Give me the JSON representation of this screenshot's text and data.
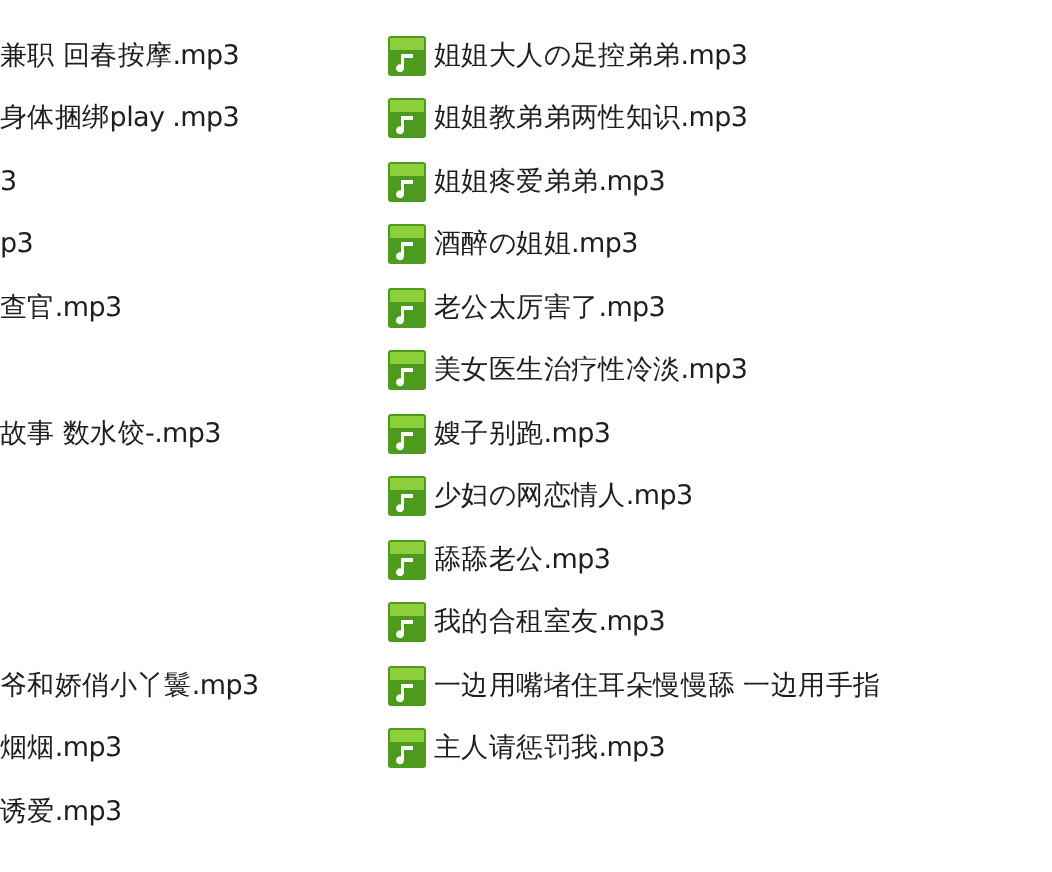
{
  "columns": [
    {
      "groups": [
        [
          {
            "name": "兼职 回春按摩.mp3"
          },
          {
            "name": "身体捆绑play .mp3"
          },
          {
            "name": "3"
          },
          {
            "name": "p3"
          },
          {
            "name": "查官.mp3"
          }
        ],
        [
          {
            "name": "故事 数水饺-.mp3"
          }
        ],
        [
          {
            "name": "爷和娇俏小丫鬟.mp3"
          },
          {
            "name": "烟烟.mp3"
          },
          {
            "name": "诱爱.mp3"
          }
        ]
      ]
    },
    {
      "groups": [
        [
          {
            "kind": "audio",
            "name": "姐姐大人の足控弟弟.mp3"
          },
          {
            "kind": "audio",
            "name": "姐姐教弟弟两性知识.mp3"
          },
          {
            "kind": "audio",
            "name": "姐姐疼爱弟弟.mp3"
          },
          {
            "kind": "audio",
            "name": "酒醉の姐姐.mp3"
          },
          {
            "kind": "audio",
            "name": "老公太厉害了.mp3"
          },
          {
            "kind": "audio",
            "name": "美女医生治疗性冷淡.mp3"
          },
          {
            "kind": "audio",
            "name": "嫂子别跑.mp3"
          },
          {
            "kind": "audio",
            "name": "少妇の网恋情人.mp3"
          },
          {
            "kind": "audio",
            "name": "舔舔老公.mp3"
          },
          {
            "kind": "audio",
            "name": "我的合租室友.mp3"
          },
          {
            "kind": "audio",
            "name": "一边用嘴堵住耳朵慢慢舔 一边用手指"
          },
          {
            "kind": "audio",
            "name": "主人请惩罚我.mp3"
          }
        ]
      ]
    }
  ]
}
